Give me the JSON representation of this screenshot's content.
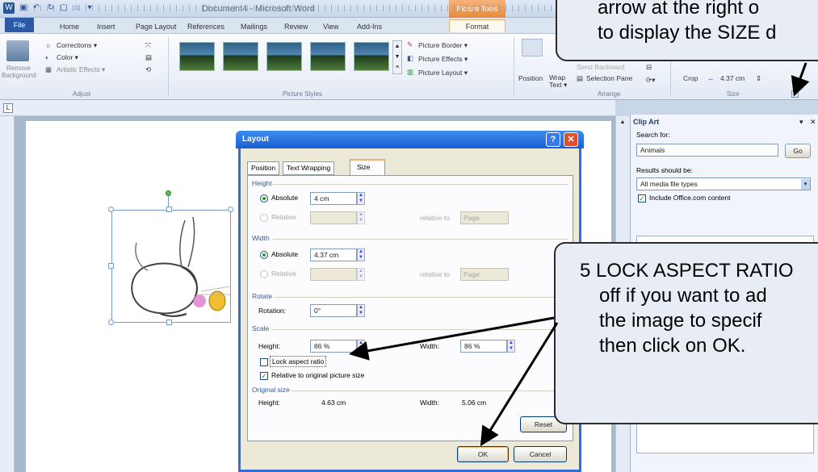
{
  "window": {
    "title": "Document4 - Microsoft Word",
    "context_tab": "Picture Tools"
  },
  "ribbon_tabs": [
    "File",
    "Home",
    "Insert",
    "Page Layout",
    "References",
    "Mailings",
    "Review",
    "View",
    "Add-Ins",
    "Format"
  ],
  "ribbon": {
    "remove_background": "Remove Background",
    "corrections": "Corrections ▾",
    "color": "Color ▾",
    "artistic_effects": "Artistic Effects ▾",
    "adjust_label": "Adjust",
    "picture_border": "Picture Border ▾",
    "picture_effects": "Picture Effects ▾",
    "picture_layout": "Picture Layout ▾",
    "picture_styles_label": "Picture Styles",
    "position": "Position",
    "wrap_text": "Wrap Text ▾",
    "send_backward": "Send Backward",
    "selection_pane": "Selection Pane",
    "arrange_label": "Arrange",
    "crop": "Crop",
    "width_value": "4.37 cm",
    "size_label": "Size"
  },
  "clip_art": {
    "title": "Clip Art",
    "search_label": "Search for:",
    "search_value": "Animals",
    "go": "Go",
    "results_label": "Results should be:",
    "results_value": "All media file types",
    "include_office": "Include Office.com content"
  },
  "dialog": {
    "title": "Layout",
    "tabs": [
      "Position",
      "Text Wrapping",
      "Size"
    ],
    "height_section": "Height",
    "absolute": "Absolute",
    "relative": "Relative",
    "height_abs_value": "4 cm",
    "relative_to": "relative to",
    "page": "Page",
    "width_section": "Width",
    "width_abs_value": "4.37 cm",
    "rotate_section": "Rotate",
    "rotation_label": "Rotation:",
    "rotation_value": "0°",
    "scale_section": "Scale",
    "scale_height_label": "Height:",
    "scale_height_value": "86 %",
    "scale_width_label": "Width:",
    "scale_width_value": "86 %",
    "lock_aspect": "Lock aspect ratio",
    "relative_original": "Relative to original picture size",
    "original_section": "Original size",
    "orig_height_label": "Height:",
    "orig_height_value": "4.63 cm",
    "orig_width_label": "Width:",
    "orig_width_value": "5.06 cm",
    "reset": "Reset",
    "ok": "OK",
    "cancel": "Cancel"
  },
  "callouts": {
    "top_lines": [
      "arrow at the right o",
      "to display the SIZE d"
    ],
    "step5_lines": [
      "5  LOCK ASPECT RATIO",
      "off if you want to ad",
      "the image to specif",
      "then click on OK."
    ]
  }
}
